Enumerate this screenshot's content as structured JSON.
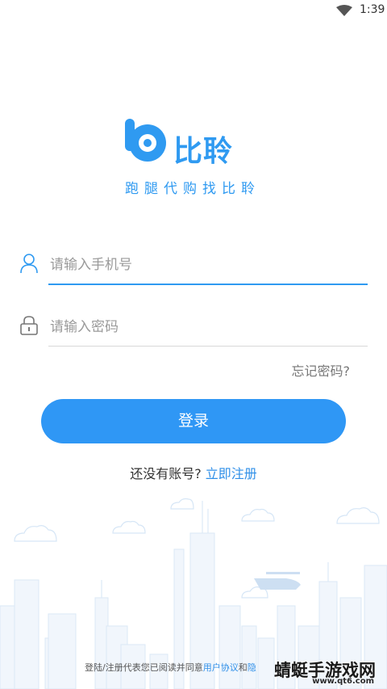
{
  "status_bar": {
    "time": "1:39",
    "wifi_icon": "wifi-icon"
  },
  "brand": {
    "name": "比聆",
    "slogan": "跑腿代购找比聆",
    "logo_icon": "b-logo-icon",
    "color": "#2f9af1"
  },
  "form": {
    "phone_placeholder": "请输入手机号",
    "password_placeholder": "请输入密码",
    "phone_icon": "user-icon",
    "password_icon": "lock-icon"
  },
  "forgot_label": "忘记密码?",
  "login_label": "登录",
  "signup": {
    "prompt": "还没有账号?",
    "link": "立即注册"
  },
  "agreement": {
    "prefix": "登陆/注册代表您已阅读并同意",
    "terms": "用户协议",
    "and": "和",
    "privacy": "隐"
  },
  "watermark": {
    "text": "蜻蜓手游戏网",
    "url": "www.qt6.com"
  },
  "colors": {
    "accent": "#2f97f5",
    "link": "#2f8fe8"
  }
}
